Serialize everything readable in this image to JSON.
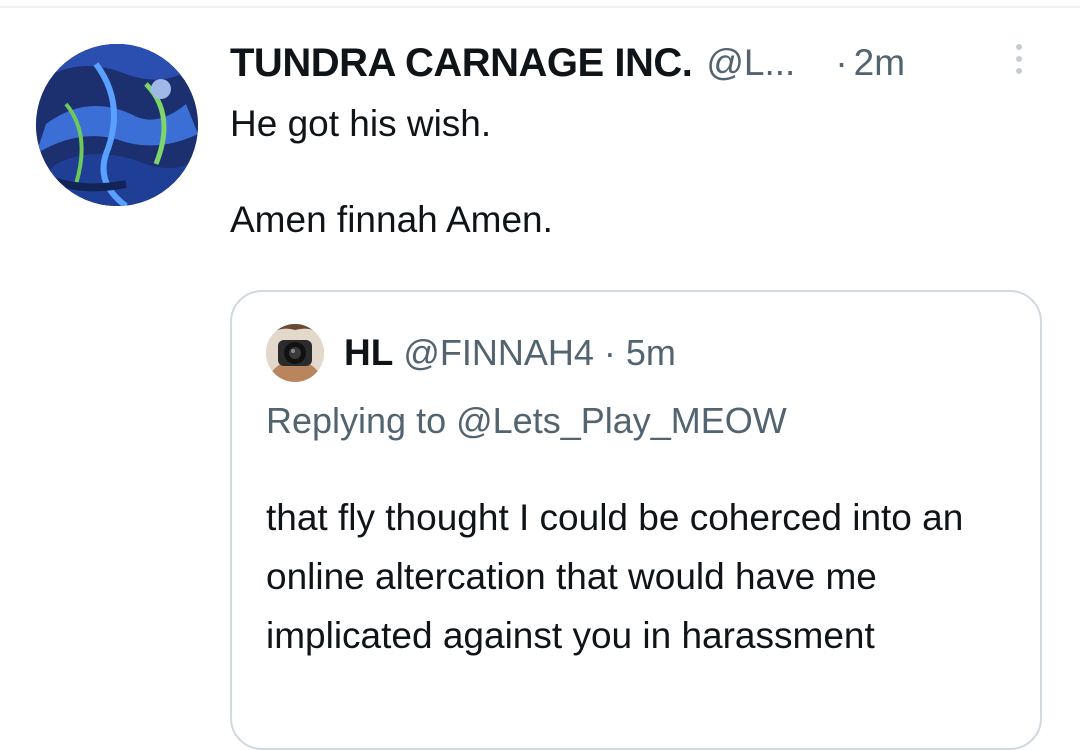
{
  "tweet": {
    "display_name": "TUNDRA CARNAGE INC.",
    "handle": "@L...",
    "separator": "·",
    "time": "2m",
    "text": "He got his wish.\n\nAmen finnah  Amen.",
    "avatar_icon": "avatar-image",
    "more_icon": "more-vertical-icon"
  },
  "quote": {
    "display_name": "HL",
    "handle": "@FINNAH4",
    "separator": "·",
    "time": "5m",
    "replying_to": "Replying to @Lets_Play_MEOW",
    "text": "that fly thought I could be coherced into an online altercation that would have me implicated against you in harassment",
    "avatar_icon": "avatar-image"
  },
  "colors": {
    "primary_text": "#0f1419",
    "secondary_text": "#536471",
    "border": "#cfd9de"
  }
}
